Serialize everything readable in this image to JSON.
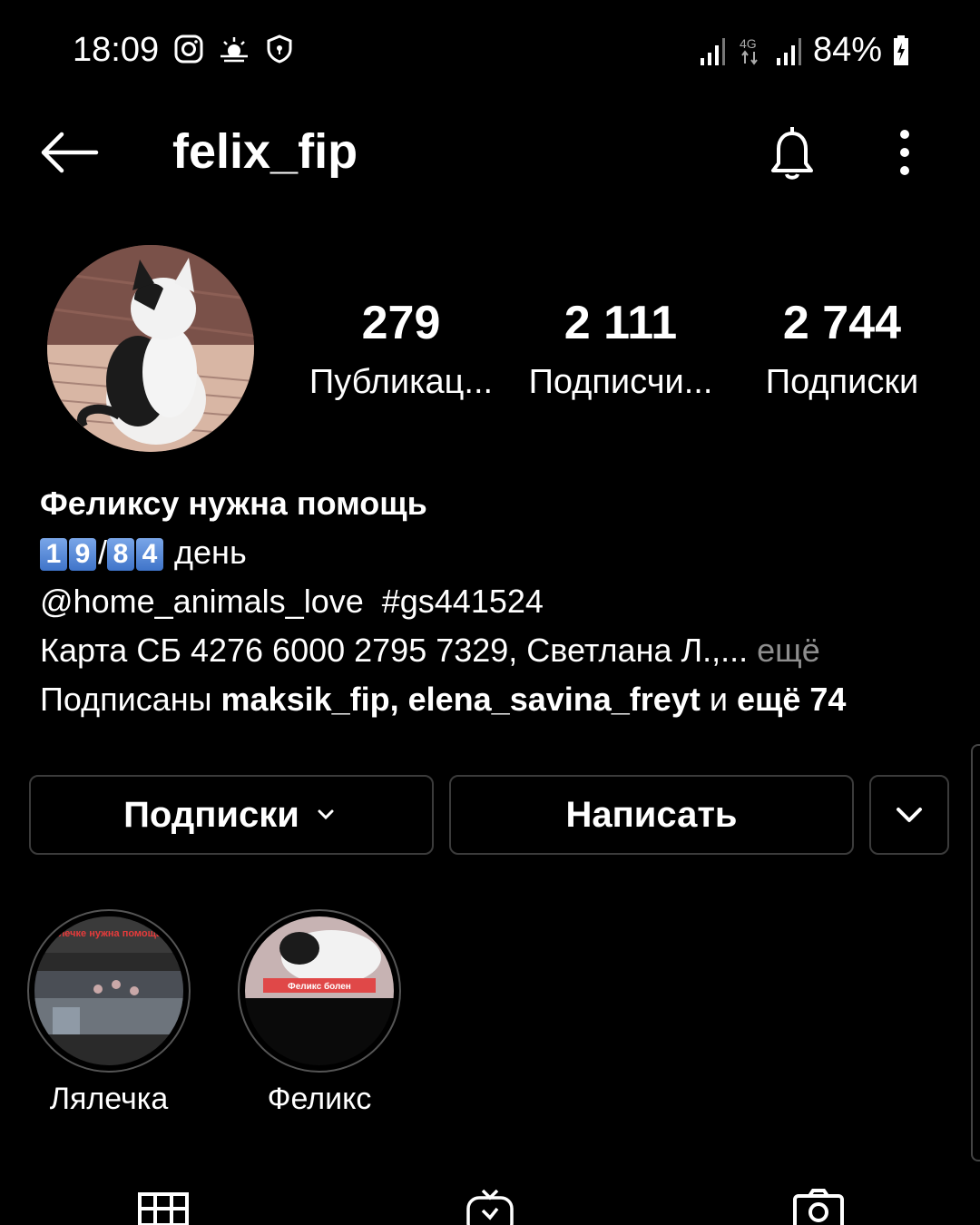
{
  "status_bar": {
    "time": "18:09",
    "battery": "84%",
    "network": "4G"
  },
  "header": {
    "username": "felix_fip"
  },
  "profile": {
    "stats": [
      {
        "count": "279",
        "label": "Публикац..."
      },
      {
        "count": "2 111",
        "label": "Подписчи..."
      },
      {
        "count": "2 744",
        "label": "Подписки"
      }
    ],
    "bio": {
      "name": "Феликсу нужна помощь",
      "day_digits_a": [
        "1",
        "9"
      ],
      "day_separator": "/",
      "day_digits_b": [
        "8",
        "4"
      ],
      "day_word": "день",
      "mention_line": "@home_animals_love  #gs441524",
      "card_line": "Карта СБ 4276 6000 2795 7329, Светлана Л.,...",
      "more": "ещё",
      "followed_prefix": "Подписаны",
      "followed_names": "maksik_fip, elena_savina_freyt",
      "followed_and": "и",
      "followed_more": "ещё 74"
    }
  },
  "buttons": {
    "following": "Подписки",
    "message": "Написать"
  },
  "highlights": [
    {
      "label": "Лялечка",
      "cover_text": "Лялечке нужна помощь!!!"
    },
    {
      "label": "Феликс",
      "cover_text": "Феликс болен"
    }
  ],
  "colors": {
    "background": "#000000",
    "text": "#ffffff",
    "muted": "#8e8e8e",
    "border": "#3b3b3b"
  }
}
